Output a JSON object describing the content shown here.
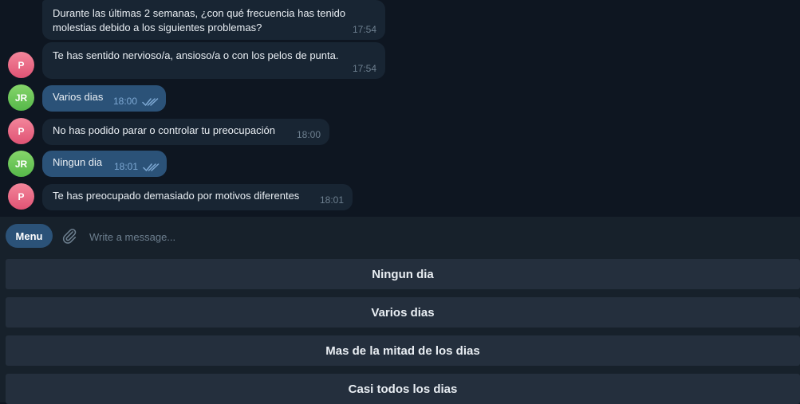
{
  "messages": [
    {
      "sender": "P",
      "direction": "in",
      "text": "Durante las últimas 2 semanas, ¿con qué frecuencia has tenido\nmolestias debido a los siguientes problemas?",
      "time": "17:54"
    },
    {
      "sender": "P",
      "direction": "in",
      "text": "Te has sentido nervioso/a, ansioso/a o con los pelos de punta.",
      "time": "17:54"
    },
    {
      "sender": "JR",
      "direction": "out",
      "text": "Varios dias",
      "time": "18:00"
    },
    {
      "sender": "P",
      "direction": "in",
      "text": "No has podido parar o controlar tu preocupación",
      "time": "18:00"
    },
    {
      "sender": "JR",
      "direction": "out",
      "text": "Ningun dia",
      "time": "18:01"
    },
    {
      "sender": "P",
      "direction": "in",
      "text": "Te has preocupado demasiado por motivos diferentes",
      "time": "18:01"
    }
  ],
  "composer": {
    "menu_label": "Menu",
    "placeholder": "Write a message..."
  },
  "keyboard": {
    "buttons": [
      "Ningun dia",
      "Varios dias",
      "Mas de la mitad de los dias",
      "Casi todos los dias"
    ]
  },
  "colors": {
    "background": "#0e1621",
    "incoming_bubble": "#182533",
    "outgoing_bubble": "#2b5278",
    "keyboard_button": "#242f3d",
    "accent": "#2b5278"
  },
  "icons": [
    "paperclip-icon",
    "double-check-icon"
  ]
}
